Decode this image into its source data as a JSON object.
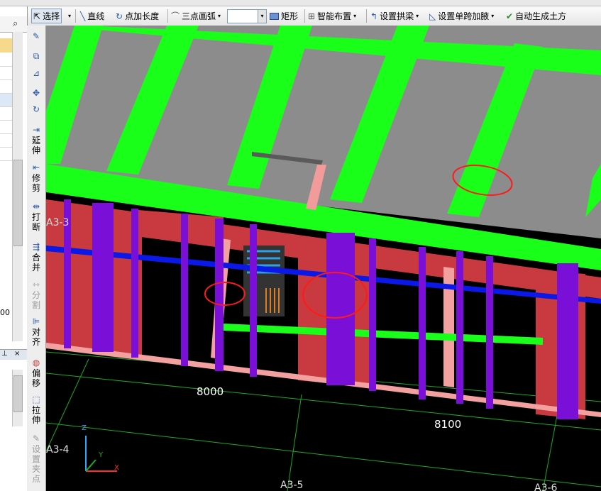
{
  "toolbar": {
    "select": "选择",
    "line": "直线",
    "point_length": "点加长度",
    "three_point_arc": "三点画弧",
    "rect": "矩形",
    "smart_layout": "智能布置",
    "set_arch_beam": "设置拱梁",
    "set_span_haunch": "设置单跨加腋",
    "auto_earthwork": "自动生成土方"
  },
  "side_tools": {
    "extend": "延伸",
    "trim": "修剪",
    "break": "打断",
    "merge": "合并",
    "split": "分割",
    "align": "对齐",
    "offset": "偏移",
    "stretch": "拉伸",
    "set_grip": "设置夹点"
  },
  "left_panel": {
    "value_fragment": "00"
  },
  "viewport": {
    "axis_labels": [
      "A3-3",
      "A3-4",
      "A3-5",
      "A3-6"
    ],
    "dimensions": [
      "8000",
      "8100"
    ],
    "coord_axes": [
      "Z",
      "Y",
      "X"
    ]
  },
  "colors": {
    "beam_green": "#1aff1a",
    "column_purple": "#7a10d8",
    "wall_red": "#c83a3f",
    "slab_gray": "#8c8c8c",
    "rebar_blue": "#0a18e8",
    "annotation_red": "#ff1a1a",
    "grid_green": "#1faa1f"
  }
}
